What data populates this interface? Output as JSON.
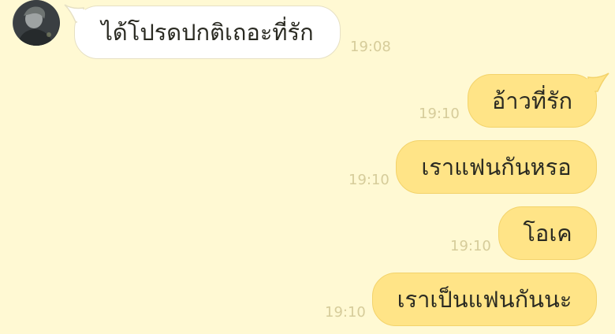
{
  "chat": {
    "messages": [
      {
        "id": "m1",
        "direction": "incoming",
        "text": "ได้โปรดปกติเถอะที่รัก",
        "time": "19:08",
        "has_avatar": true
      },
      {
        "id": "m2",
        "direction": "outgoing",
        "text": "อ้าวที่รัก",
        "time": "19:10"
      },
      {
        "id": "m3",
        "direction": "outgoing",
        "text": "เราแฟนกันหรอ",
        "time": "19:10"
      },
      {
        "id": "m4",
        "direction": "outgoing",
        "text": "โอเค",
        "time": "19:10"
      },
      {
        "id": "m5",
        "direction": "outgoing",
        "text": "เราเป็นแฟนกันนะ",
        "time": "19:10"
      }
    ]
  },
  "colors": {
    "background": "#fff9d3",
    "incoming_bubble": "#ffffff",
    "outgoing_bubble": "#ffe487",
    "timestamp": "#d6cc9a"
  }
}
